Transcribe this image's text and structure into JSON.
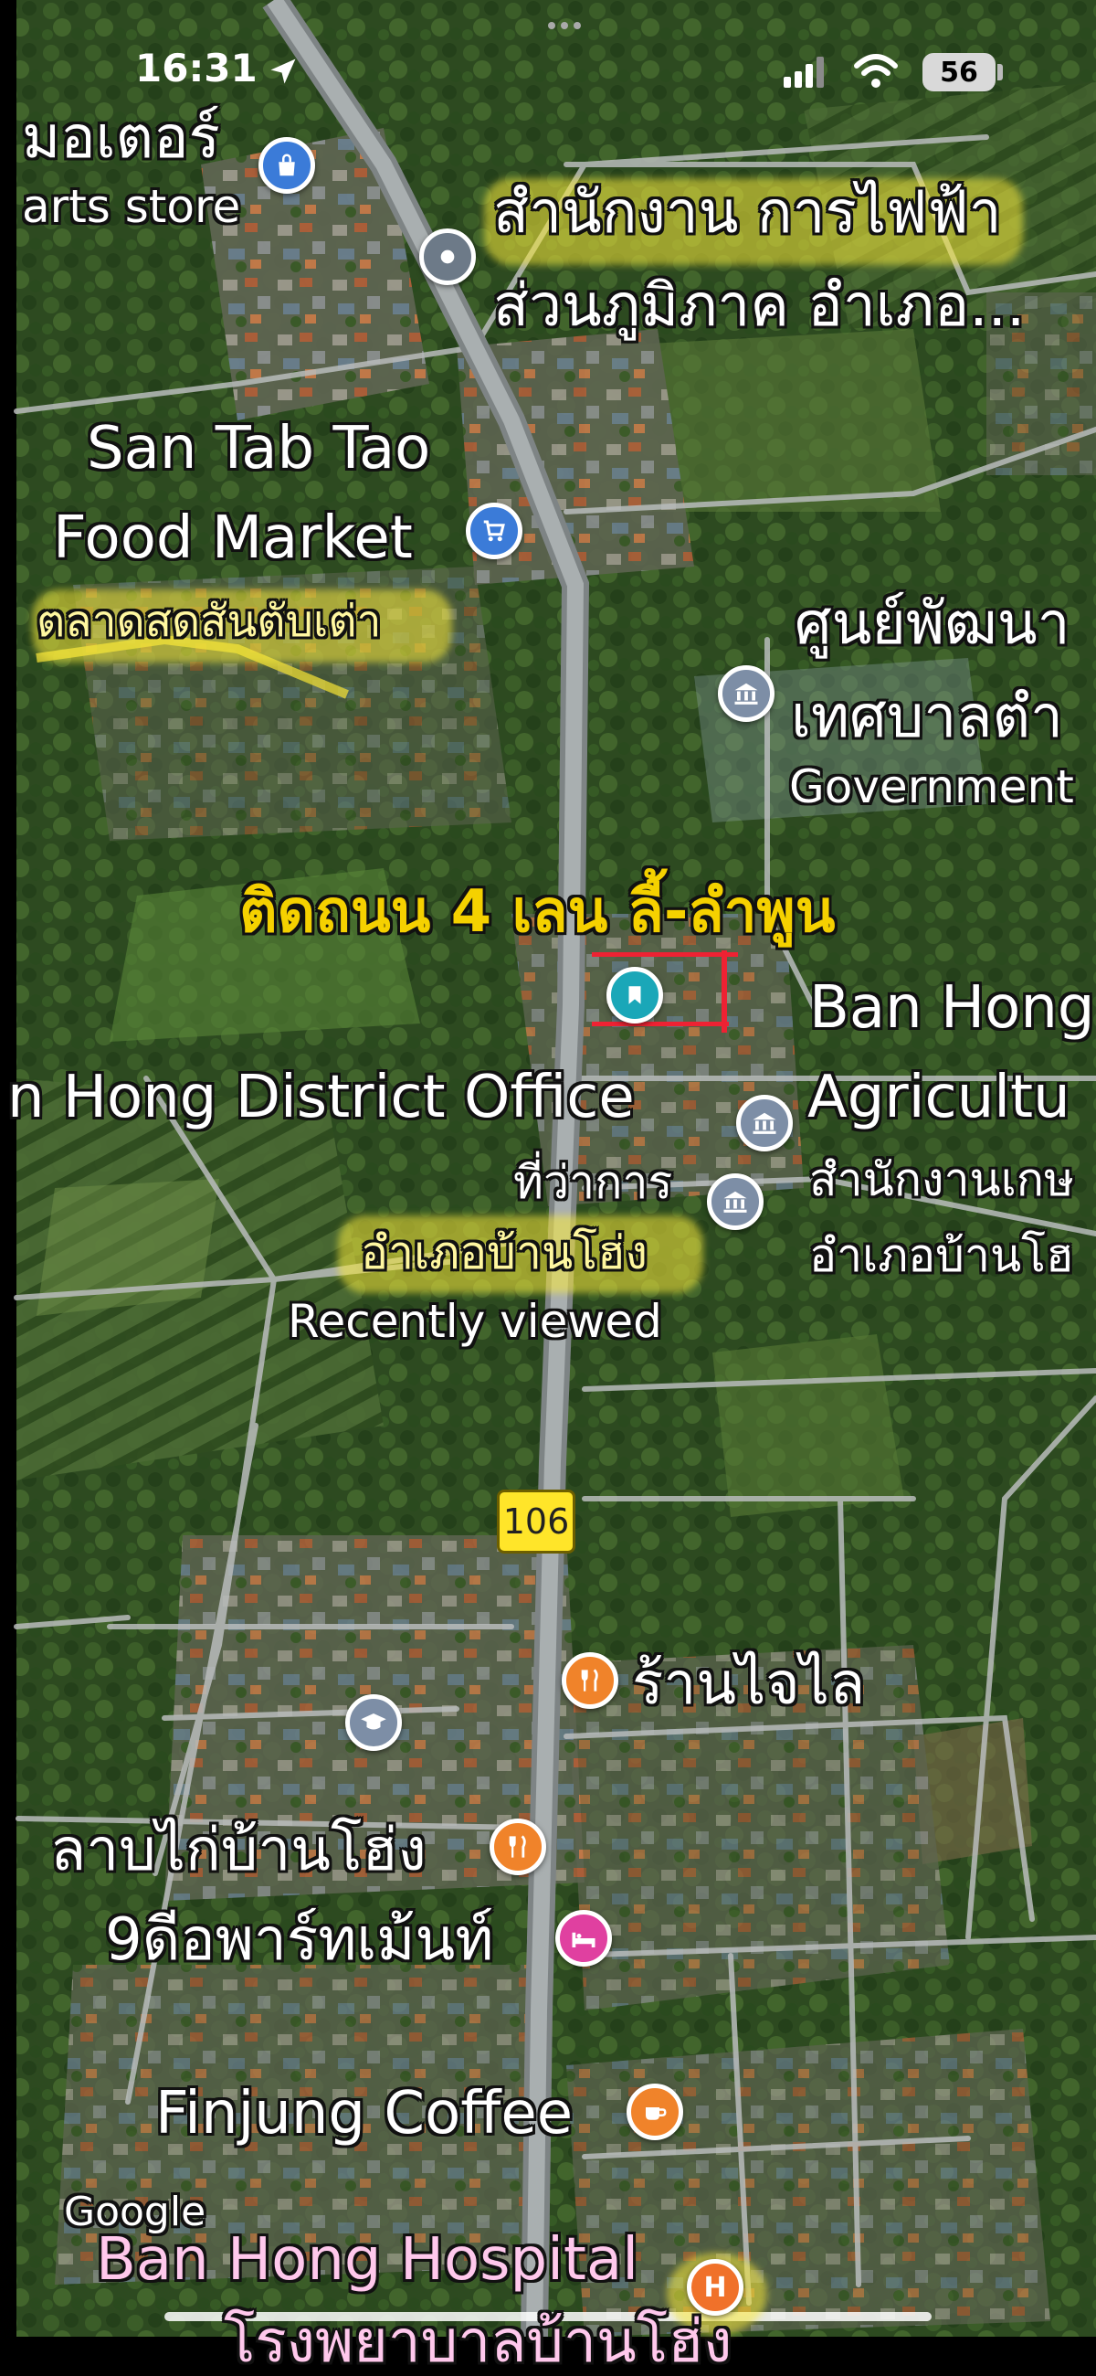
{
  "status_bar": {
    "time": "16:31",
    "battery": "56"
  },
  "map": {
    "route_number": "106",
    "announcement": "ติดถนน 4 เลน ลี้-ลำพูน",
    "labels": {
      "top_left_partial": "",
      "parts_store_thai": "มอเตอร์",
      "parts_store_en": "arts store",
      "electric_office_line1": "สำนักงาน การไฟฟ้า",
      "electric_office_line2": "ส่วนภูมิภาค อำเภอ...",
      "food_market_line1": "San Tab Tao",
      "food_market_line2": "Food Market",
      "food_market_thai": "ตลาดสดสันตับเต่า",
      "gov_center_line1": "ศูนย์พัฒนา",
      "gov_center_line2": "เทศบาลตำ",
      "gov_center_line3": "Government",
      "ban_hong_agri_line1": "Ban Hong",
      "ban_hong_agri_line2": "Agricultu",
      "district_office": "n Hong District Office",
      "agri_thai_line1": "สำนักงานเกษ",
      "agri_thai_line2": "อำเภอบ้านโฮ",
      "district_thai_line1": "ที่ว่าการ",
      "district_thai_line2": "อำเภอบ้านโฮ่ง",
      "recently_viewed": "Recently viewed",
      "restaurant_1": "ร้านไจไล",
      "laab_restaurant": "ลาบไก่บ้านโฮ่ง",
      "apartment": "9ดีอพาร์ทเม้นท์",
      "coffee": "Finjung Coffee",
      "google": "Google",
      "hospital": "Ban Hong Hospital",
      "hospital_thai": "โรงพยาบาลบ้านโฮ่ง"
    },
    "colors": {
      "store_pin": "#3b7bd8",
      "govt_pin": "#7d8ea6",
      "generic_pin": "#6d7a88",
      "food_pin": "#f0832a",
      "hotel_pin": "#e040a0",
      "saved_pin": "#1aa7b8",
      "hospital_pin": "#f0712a",
      "highlight": "#f5d100"
    }
  }
}
